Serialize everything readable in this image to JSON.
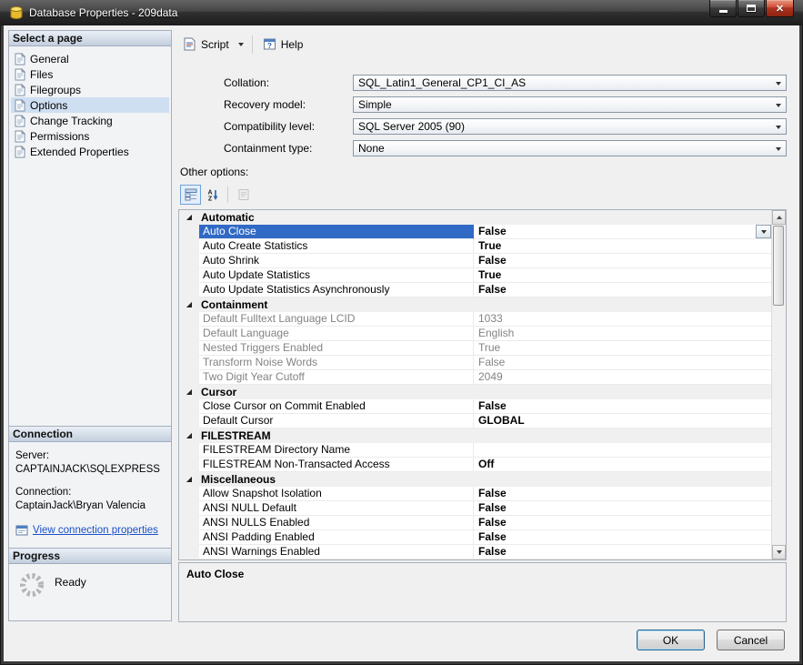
{
  "colors": {
    "selection": "#316AC5",
    "link": "#1A50C8",
    "header_gradient_top": "#EAEFF6",
    "header_gradient_bottom": "#C3CEDD",
    "close_button": "#AD3220"
  },
  "icons": {
    "window": "database-icon",
    "sidebar_item": "page-icon",
    "script": "script-icon",
    "help": "help-icon",
    "categorized": "categorized-icon",
    "alphabetical": "az-sort-icon",
    "property_pages": "property-pages-icon",
    "connection_link": "connection-properties-icon",
    "progress": "progress-spinner-icon",
    "category_expand": "collapse-triangle-icon"
  },
  "window": {
    "title": "Database Properties - 209data"
  },
  "sidebar": {
    "header": "Select a page",
    "items": [
      {
        "label": "General"
      },
      {
        "label": "Files"
      },
      {
        "label": "Filegroups"
      },
      {
        "label": "Options"
      },
      {
        "label": "Change Tracking"
      },
      {
        "label": "Permissions"
      },
      {
        "label": "Extended Properties"
      }
    ]
  },
  "toolbar": {
    "script": "Script",
    "help": "Help"
  },
  "form": {
    "fields": [
      {
        "label": "Collation:",
        "value": "SQL_Latin1_General_CP1_CI_AS"
      },
      {
        "label": "Recovery model:",
        "value": "Simple"
      },
      {
        "label": "Compatibility level:",
        "value": "SQL Server 2005 (90)"
      },
      {
        "label": "Containment type:",
        "value": "None"
      }
    ],
    "other_options": "Other options:"
  },
  "property_grid": {
    "groups": [
      {
        "name": "Automatic",
        "rows": [
          {
            "property": "Auto Close",
            "value": "False"
          },
          {
            "property": "Auto Create Statistics",
            "value": "True"
          },
          {
            "property": "Auto Shrink",
            "value": "False"
          },
          {
            "property": "Auto Update Statistics",
            "value": "True"
          },
          {
            "property": "Auto Update Statistics Asynchronously",
            "value": "False"
          }
        ]
      },
      {
        "name": "Containment",
        "rows": [
          {
            "property": "Default Fulltext Language LCID",
            "value": "1033"
          },
          {
            "property": "Default Language",
            "value": "English"
          },
          {
            "property": "Nested Triggers Enabled",
            "value": "True"
          },
          {
            "property": "Transform Noise Words",
            "value": "False"
          },
          {
            "property": "Two Digit Year Cutoff",
            "value": "2049"
          }
        ]
      },
      {
        "name": "Cursor",
        "rows": [
          {
            "property": "Close Cursor on Commit Enabled",
            "value": "False"
          },
          {
            "property": "Default Cursor",
            "value": "GLOBAL"
          }
        ]
      },
      {
        "name": "FILESTREAM",
        "rows": [
          {
            "property": "FILESTREAM Directory Name",
            "value": ""
          },
          {
            "property": "FILESTREAM Non-Transacted Access",
            "value": "Off"
          }
        ]
      },
      {
        "name": "Miscellaneous",
        "rows": [
          {
            "property": "Allow Snapshot Isolation",
            "value": "False"
          },
          {
            "property": "ANSI NULL Default",
            "value": "False"
          },
          {
            "property": "ANSI NULLS Enabled",
            "value": "False"
          },
          {
            "property": "ANSI Padding Enabled",
            "value": "False"
          },
          {
            "property": "ANSI Warnings Enabled",
            "value": "False"
          }
        ]
      }
    ]
  },
  "description": {
    "title": "Auto Close"
  },
  "connection": {
    "header": "Connection",
    "server_label": "Server:",
    "server": "CAPTAINJACK\\SQLEXPRESS",
    "connection_label": "Connection:",
    "user": "CaptainJack\\Bryan Valencia",
    "link": "View connection properties"
  },
  "progress": {
    "header": "Progress",
    "status": "Ready"
  },
  "buttons": {
    "ok": "OK",
    "cancel": "Cancel"
  }
}
